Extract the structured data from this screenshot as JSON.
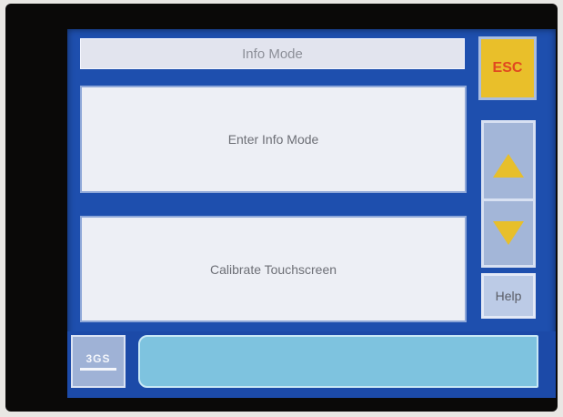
{
  "header": {
    "title": "Info Mode"
  },
  "menu": {
    "items": [
      {
        "label": "Enter Info Mode"
      },
      {
        "label": "Calibrate Touchscreen"
      }
    ]
  },
  "side": {
    "esc_label": "ESC",
    "help_label": "Help"
  },
  "footer": {
    "logo_text": "3GS",
    "status_text": ""
  },
  "colors": {
    "screen_background": "#1e4fae",
    "esc_button": "#e9bf2a",
    "arrow_fill": "#e7bf2b",
    "status_bar": "#7ec3df"
  },
  "icons": [
    "up-arrow-icon",
    "down-arrow-icon"
  ]
}
